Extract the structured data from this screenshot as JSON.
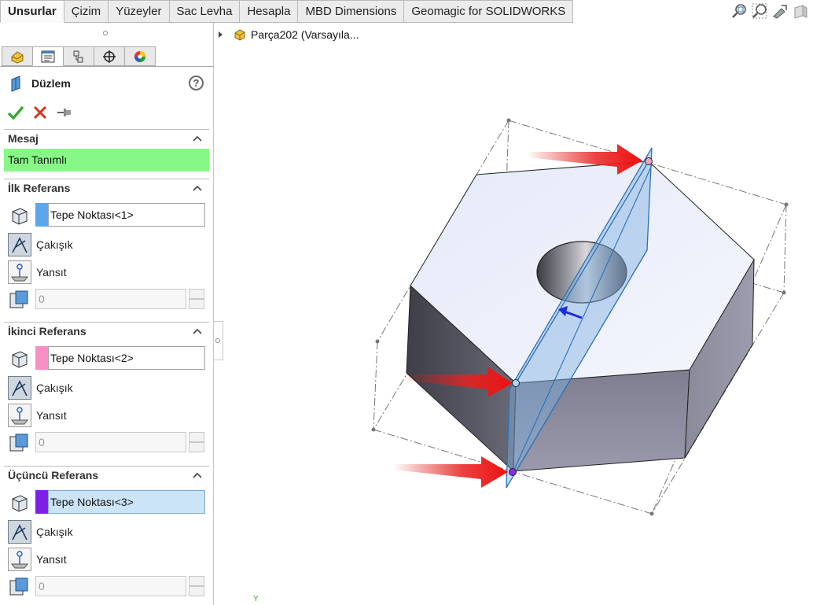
{
  "command_tabs": [
    "Unsurlar",
    "Çizim",
    "Yüzeyler",
    "Sac Levha",
    "Hesapla",
    "MBD Dimensions",
    "Geomagic for SOLIDWORKS"
  ],
  "active_tab": "Unsurlar",
  "view_tools": [
    "zoom-fit-icon",
    "zoom-area-icon",
    "previous-view-icon",
    "section-view-icon"
  ],
  "property_manager": {
    "tabs": [
      "feature-manager-icon",
      "property-manager-icon",
      "configuration-manager-icon",
      "dimxpert-icon",
      "display-manager-icon"
    ],
    "title": "Düzlem",
    "help_label": "?",
    "message_header": "Mesaj",
    "message_text": "Tam Tanımlı",
    "groups": [
      {
        "header": "İlk Referans",
        "selection": "Tepe Noktası<1>",
        "color": "#5aa7ee",
        "option1": "Çakışık",
        "option2": "Yansıt",
        "count": "0"
      },
      {
        "header": "İkinci Referans",
        "selection": "Tepe Noktası<2>",
        "color": "#f78fc4",
        "option1": "Çakışık",
        "option2": "Yansıt",
        "count": "0"
      },
      {
        "header": "Üçüncü Referans",
        "selection": "Tepe Noktası<3>",
        "color": "#7f1fe6",
        "option1": "Çakışık",
        "option2": "Yansıt",
        "count": "0"
      }
    ]
  },
  "feature_tree": {
    "root_label": "Parça202  (Varsayıla..."
  },
  "viewport": {
    "axis_label": "Y"
  },
  "colors": {
    "message_bg": "#87f887",
    "plane": "#7fb0e0",
    "face_top": "#eaeefa",
    "face_side_dark": "#5a5a66",
    "face_side_mid": "#7d7d8e",
    "arrow": "#e01010"
  }
}
